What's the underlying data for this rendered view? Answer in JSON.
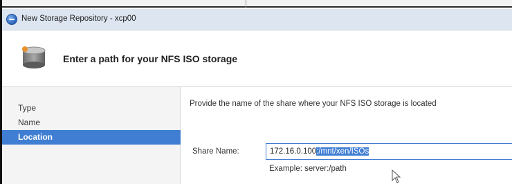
{
  "window": {
    "title": "New Storage Repository - xcp00",
    "icon": "xenserver-app-icon"
  },
  "header": {
    "icon": "storage-disk-icon",
    "heading": "Enter a path for your NFS ISO storage"
  },
  "sidebar": {
    "items": [
      {
        "label": "Type",
        "selected": false
      },
      {
        "label": "Name",
        "selected": false
      },
      {
        "label": "Location",
        "selected": true
      }
    ]
  },
  "main": {
    "description": "Provide the name of the share where your NFS ISO storage is located",
    "share_name": {
      "label": "Share Name:",
      "value_plain": "172.16.0.100",
      "value_selected": ":/mnt/xen/ISOs"
    },
    "example": "Example: server:/path"
  },
  "colors": {
    "selection": "#3f7ed3",
    "titlebar": "#dde6f0",
    "sidebar": "#f4f4f4"
  }
}
